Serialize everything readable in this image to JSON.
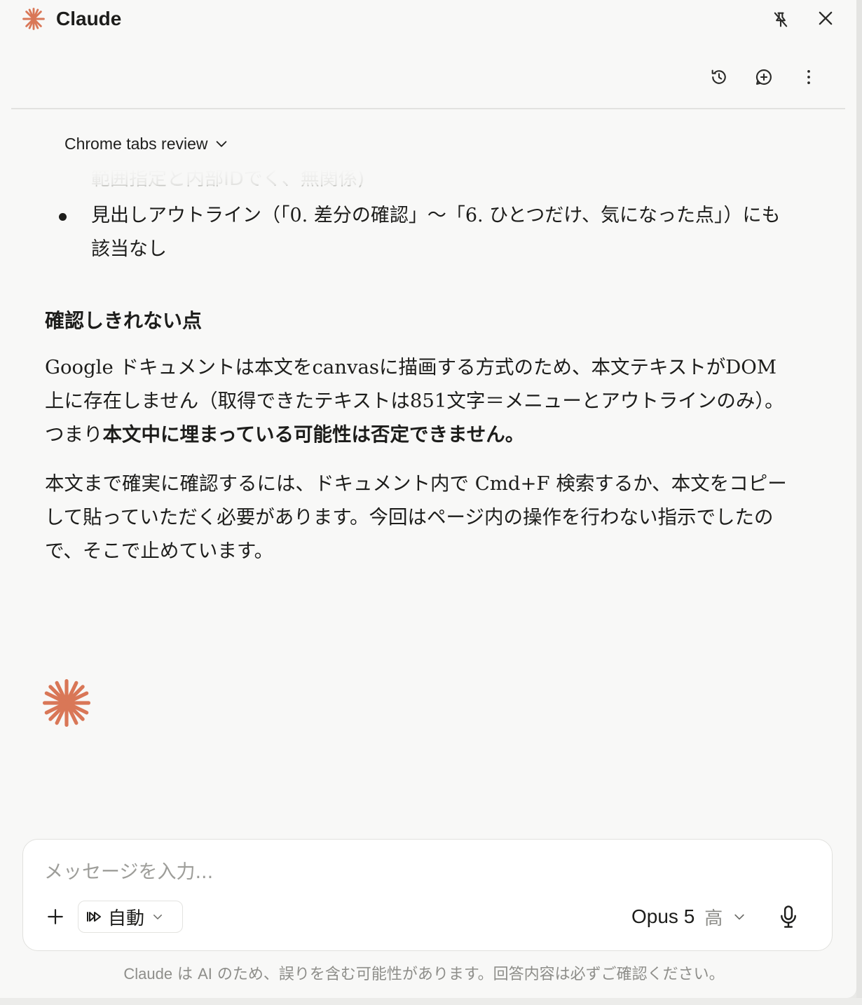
{
  "app": {
    "title": "Claude"
  },
  "window_controls": {
    "unpin_icon": "pin-off-icon",
    "close_icon": "close-icon"
  },
  "toolbar": {
    "history_icon": "history-icon",
    "new_chat_icon": "new-chat-icon",
    "more_icon": "more-vertical-icon"
  },
  "conversation": {
    "title": "Chrome tabs review",
    "faded_line": "範囲指定と内部IDでく、無関係)",
    "bullets": [
      "見出しアウトライン（「0. 差分の確認」〜「6. ひとつだけ、気になった点」）にも該当なし"
    ],
    "heading": "確認しきれない点",
    "para1_before": "Google ドキュメントは本文をcanvasに描画する方式のため、本文テキストがDOM上に存在しません（取得できたテキストは851文字＝メニューとアウトラインのみ）。つまり",
    "para1_bold": "本文中に埋まっている可能性は否定できません。",
    "para2": "本文まで確実に確認するには、ドキュメント内で Cmd+F 検索するか、本文をコピーして貼っていただく必要があります。今回はページ内の操作を行わない指示でしたので、そこで止めています。"
  },
  "composer": {
    "placeholder": "メッセージを入力...",
    "mode_label": "自動",
    "model_name": "Opus 5",
    "effort_label": "高"
  },
  "footer": {
    "disclaimer_brand": "Claude",
    "disclaimer_text": " は ",
    "disclaimer_ai": "AI",
    "disclaimer_rest": " のため、誤りを含む可能性があります。回答内容は必ずご確認ください。"
  },
  "colors": {
    "accent": "#d97757",
    "text": "#1d1d1b",
    "muted": "#8e8e8a",
    "background": "#f8f8f7"
  }
}
